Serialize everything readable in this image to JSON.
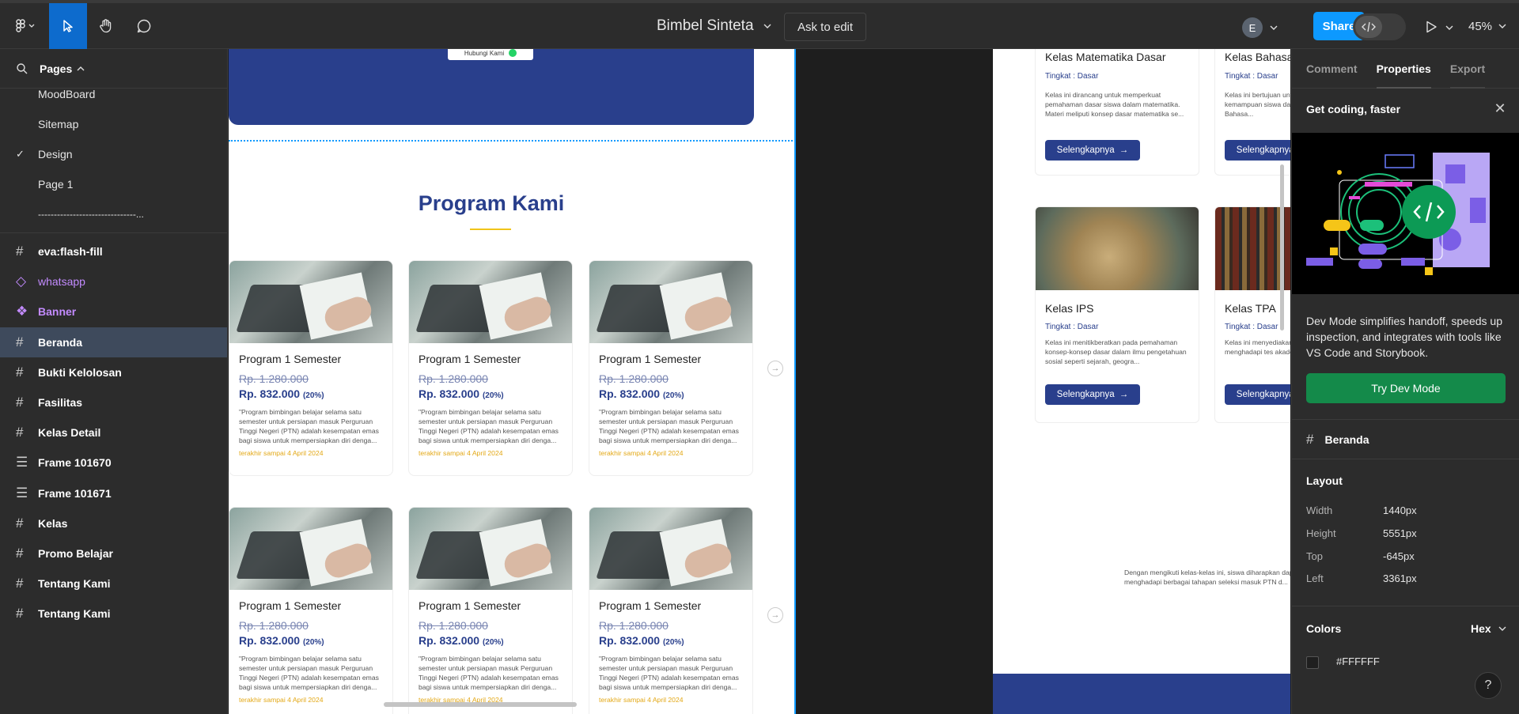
{
  "app": {
    "file_title": "Bimbel Sinteta",
    "ask_to_edit": "Ask to edit",
    "share": "Share",
    "zoom": "45%",
    "avatar_initial": "E"
  },
  "pages": {
    "header": "Pages",
    "items": [
      "MoodBoard",
      "Sitemap",
      "Design",
      "Page 1",
      "-------------------------------..."
    ],
    "selected": "Design"
  },
  "layers": [
    {
      "name": "eva:flash-fill",
      "icon": "frame-icon"
    },
    {
      "name": "whatsapp",
      "icon": "component-instance-icon"
    },
    {
      "name": "Banner",
      "icon": "component-icon"
    },
    {
      "name": "Beranda",
      "icon": "frame-icon"
    },
    {
      "name": "Bukti Kelolosan",
      "icon": "frame-icon"
    },
    {
      "name": "Fasilitas",
      "icon": "frame-icon"
    },
    {
      "name": "Kelas Detail",
      "icon": "frame-icon"
    },
    {
      "name": "Frame 101670",
      "icon": "auto-layout-icon"
    },
    {
      "name": "Frame 101671",
      "icon": "auto-layout-icon"
    },
    {
      "name": "Kelas",
      "icon": "frame-icon"
    },
    {
      "name": "Promo Belajar",
      "icon": "frame-icon"
    },
    {
      "name": "Tentang Kami",
      "icon": "frame-icon"
    },
    {
      "name": "Tentang Kami",
      "icon": "frame-icon"
    }
  ],
  "canvas": {
    "hubungi_kami": "Hubungi Kami",
    "section_title": "Program Kami",
    "program_card": {
      "title": "Program 1 Semester",
      "old_price": "Rp. 1.280.000",
      "new_price": "Rp. 832.000",
      "discount": "(20%)",
      "desc": "\"Program bimbingan belajar selama satu semester untuk persiapan masuk Perguruan Tinggi Negeri (PTN) adalah kesempatan emas bagi siswa untuk mempersiapkan diri denga...",
      "deadline": "terakhir sampai 4 April 2024"
    },
    "kelas": [
      {
        "title": "Kelas Matematika Dasar",
        "level": "Tingkat : Dasar",
        "desc": " Kelas ini dirancang untuk memperkuat pemahaman dasar siswa dalam matematika. Materi meliputi konsep dasar matematika se...",
        "button": "Selengkapnya"
      },
      {
        "title": "Kelas Bahasa",
        "level": "Tingkat : Dasar",
        "desc": "Kelas ini bertujuan untuk meningkatkan kemampuan siswa dalam menggunakan Bahasa...",
        "button": "Selengkapnya"
      },
      {
        "title": "Kelas IPS",
        "level": "Tingkat : Dasar",
        "desc": "Kelas ini menitikberatkan pada pemahaman konsep-konsep dasar dalam ilmu pengetahuan sosial seperti sejarah, geogra...",
        "button": "Selengkapnya"
      },
      {
        "title": "Kelas TPA",
        "level": "Tingkat : Dasar",
        "desc": "Kelas ini menyediakan latihan khusus untuk menghadapi tes akademik (TPA) yang...",
        "button": "Selengkapnya"
      }
    ],
    "footnote_line1": "Dengan mengikuti kelas-kelas ini, siswa diharapkan dapat",
    "footnote_line2": "menghadapi berbagai tahapan seleksi masuk PTN d..."
  },
  "right_panel": {
    "tabs": [
      "Comment",
      "Properties",
      "Export"
    ],
    "active_tab": "Properties",
    "promo_title": "Get coding, faster",
    "promo_desc": "Dev Mode simplifies handoff, speeds up inspection, and integrates with tools like VS Code and Storybook.",
    "promo_button": "Try Dev Mode",
    "selection_name": "Beranda",
    "layout_header": "Layout",
    "layout": [
      {
        "label": "Width",
        "value": "1440px"
      },
      {
        "label": "Height",
        "value": "5551px"
      },
      {
        "label": "Top",
        "value": "-645px"
      },
      {
        "label": "Left",
        "value": "3361px"
      }
    ],
    "colors_header": "Colors",
    "color_format": "Hex",
    "color_value": "#FFFFFF"
  },
  "colors": {
    "brand_blue": "#293f8c",
    "accent_yellow": "#f0c419",
    "figma_blue": "#0d99ff",
    "share_blue": "#0d99ff",
    "dev_green": "#148a4a"
  }
}
